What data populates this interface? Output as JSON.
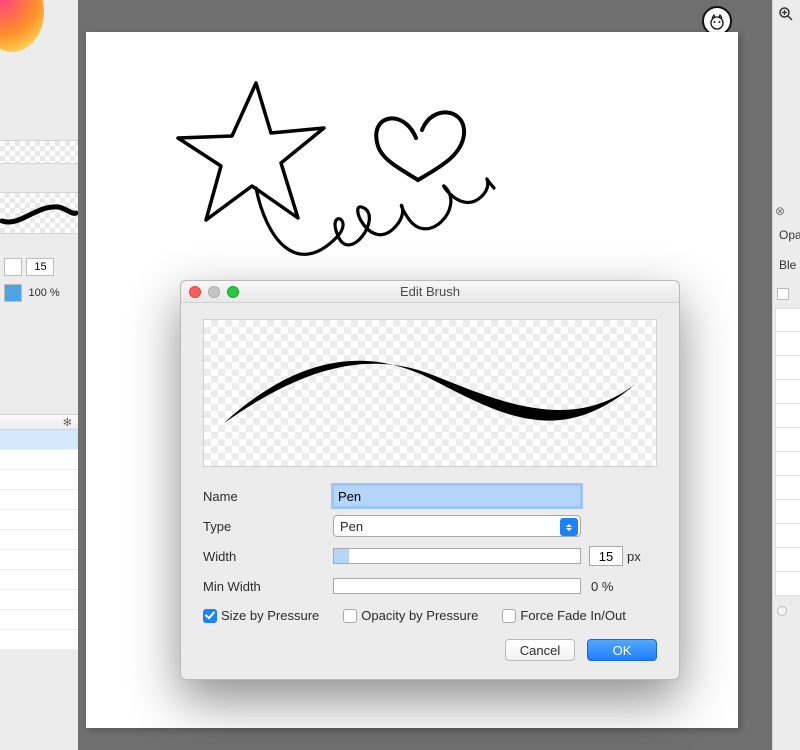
{
  "dialog": {
    "title": "Edit Brush",
    "fields": {
      "name_label": "Name",
      "name_value": "Pen",
      "type_label": "Type",
      "type_value": "Pen",
      "width_label": "Width",
      "width_value": "15",
      "width_unit": "px",
      "width_slider_percent": 6,
      "min_width_label": "Min Width",
      "min_width_value": "0 %"
    },
    "checkboxes": {
      "size_by_pressure": {
        "label": "Size by Pressure",
        "checked": true
      },
      "opacity_by_pressure": {
        "label": "Opacity by Pressure",
        "checked": false
      },
      "force_fade": {
        "label": "Force Fade In/Out",
        "checked": false
      }
    },
    "buttons": {
      "cancel": "Cancel",
      "ok": "OK"
    }
  },
  "left_panel": {
    "brush_size_value": "15",
    "opacity_value": "100 %"
  },
  "right_panel": {
    "opacity_abbr": "Opa",
    "blend_abbr": "Ble"
  }
}
